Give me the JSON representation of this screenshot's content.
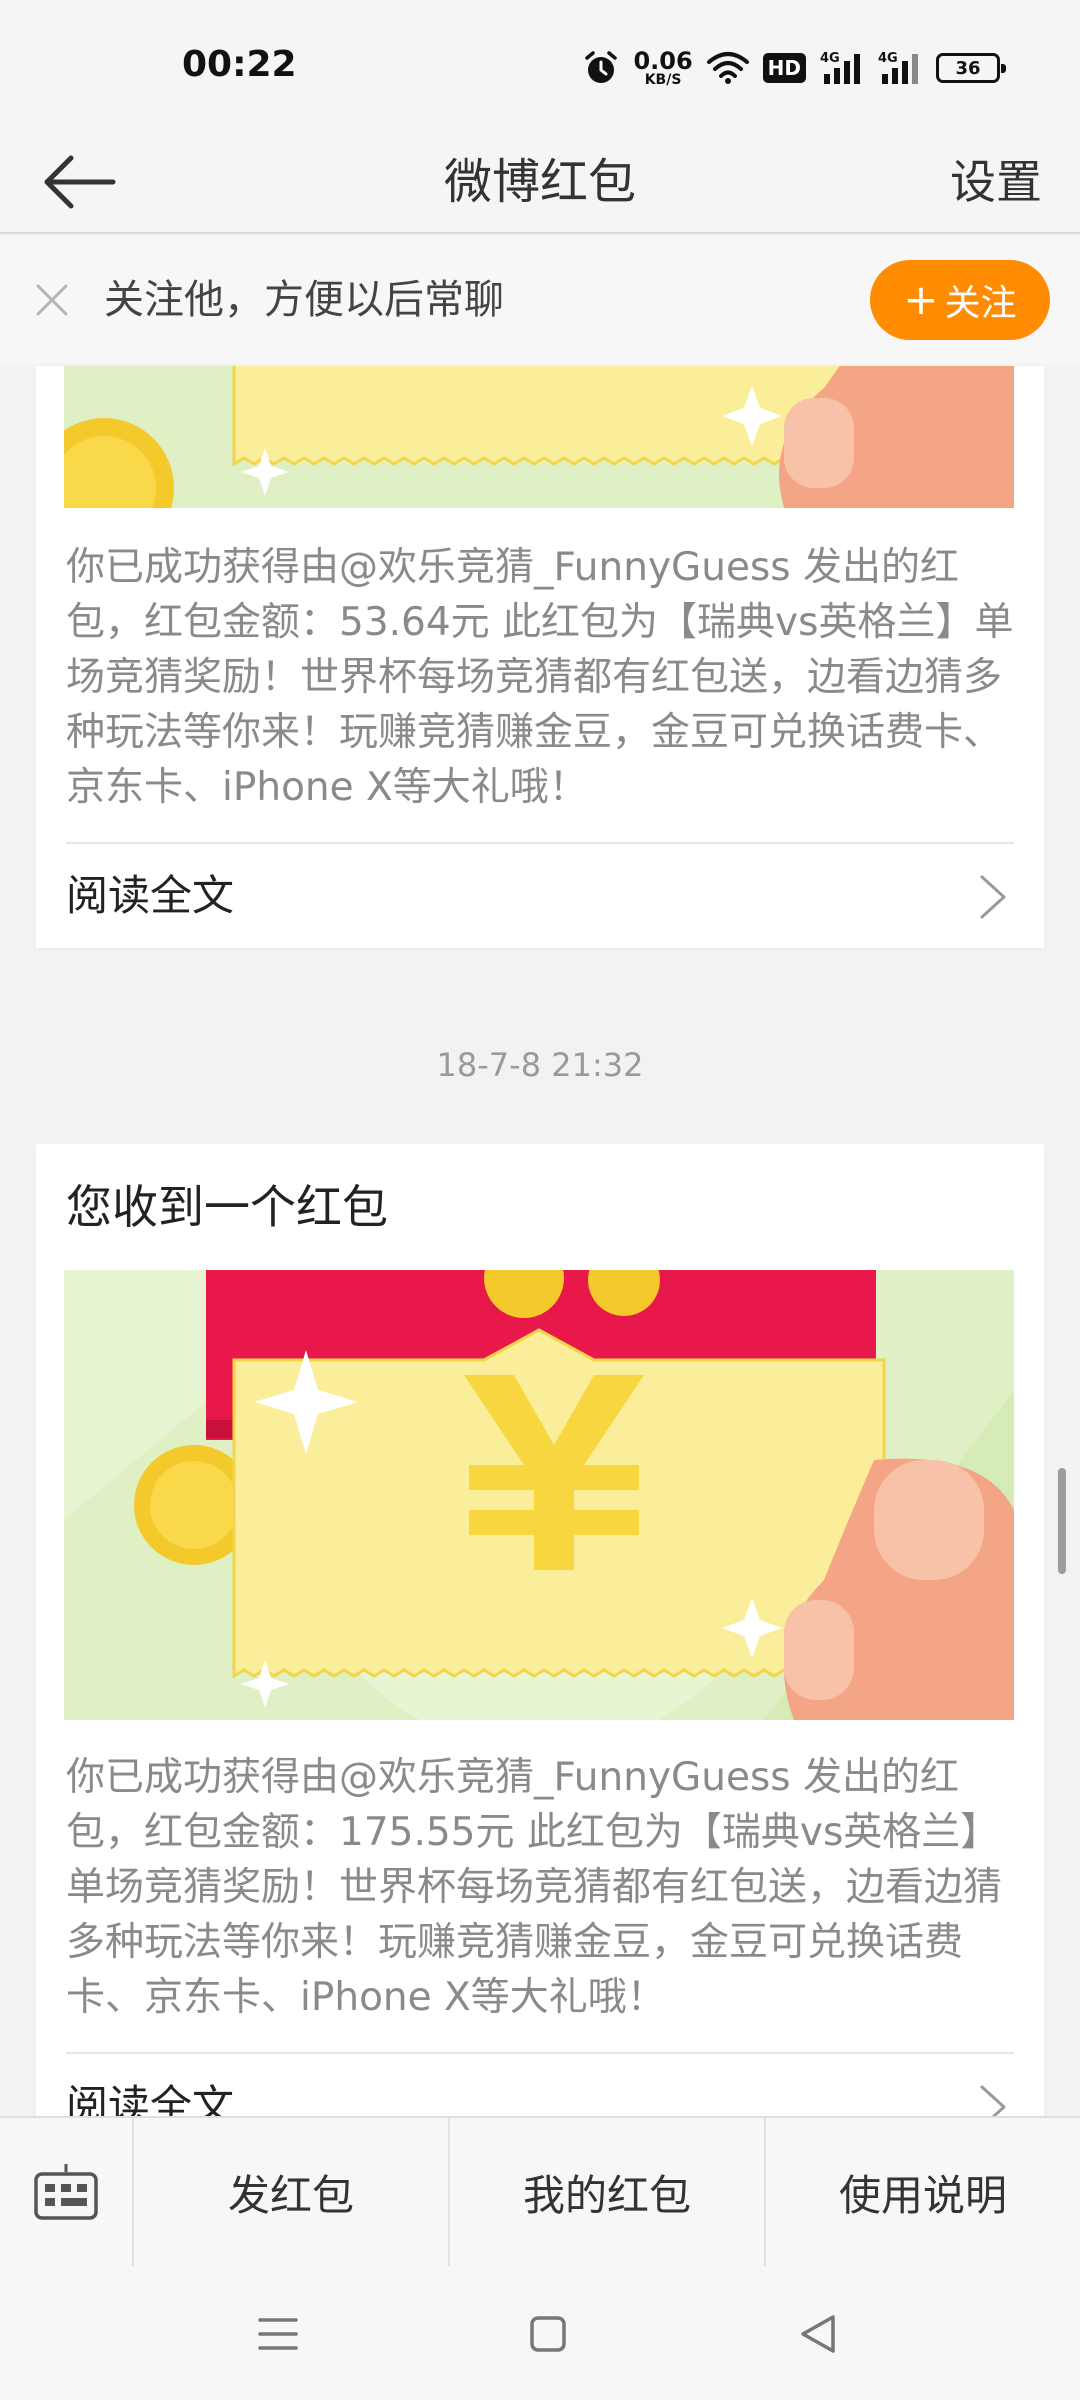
{
  "status_bar": {
    "time": "00:22",
    "net_speed_value": "0.06",
    "net_speed_unit": "KB/S",
    "hd_label": "HD",
    "signal_label_1": "4G",
    "signal_label_2": "4G",
    "battery_level": "36",
    "icons": [
      "alarm-icon",
      "wifi-icon",
      "hd-icon",
      "signal-4g-icon",
      "signal-4g-icon",
      "battery-icon"
    ]
  },
  "nav": {
    "title": "微博红包",
    "settings_label": "设置"
  },
  "follow_banner": {
    "text": "关注他，方便以后常聊",
    "button_label": "关注",
    "button_color": "#ff8b00"
  },
  "cards": [
    {
      "title": "",
      "body": "你已成功获得由@欢乐竞猜_FunnyGuess 发出的红包，红包金额：53.64元 此红包为【瑞典vs英格兰】单场竞猜奖励！世界杯每场竞猜都有红包送，边看边猜多种玩法等你来！玩赚竞猜赚金豆，金豆可兑换话费卡、京东卡、iPhone X等大礼哦！",
      "read_more": "阅读全文"
    },
    {
      "title": "您收到一个红包",
      "body": "你已成功获得由@欢乐竞猜_FunnyGuess 发出的红包，红包金额：175.55元 此红包为【瑞典vs英格兰】单场竞猜奖励！世界杯每场竞猜都有红包送，边看边猜多种玩法等你来！玩赚竞猜赚金豆，金豆可兑换话费卡、京东卡、iPhone X等大礼哦！",
      "read_more": "阅读全文"
    }
  ],
  "timestamp": "18-7-8 21:32",
  "toolbar": {
    "send_label": "发红包",
    "mine_label": "我的红包",
    "help_label": "使用说明"
  },
  "colors": {
    "accent": "#ff8b00",
    "envelope_red": "#e8194a",
    "coin_gold": "#f5c400",
    "background_green": "#dff0c4"
  }
}
